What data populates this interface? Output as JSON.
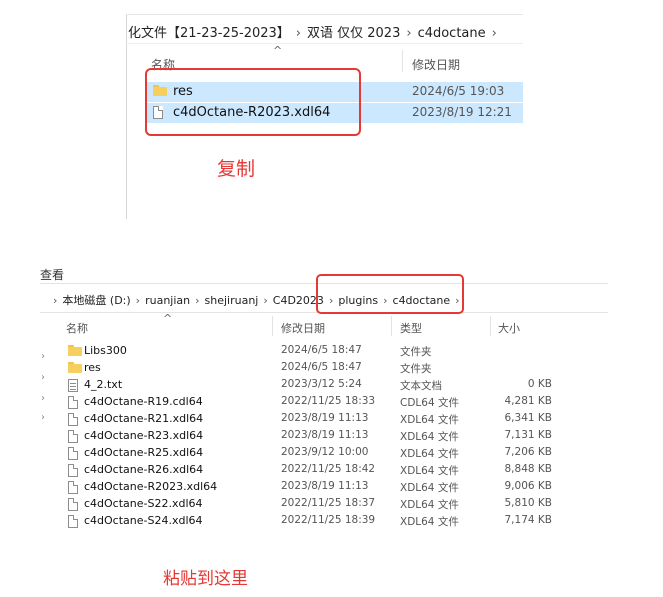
{
  "top_window": {
    "breadcrumb": [
      "化文件【21-23-25-2023】",
      "双语 仅仅 2023",
      "c4doctane"
    ],
    "sort_arrow": "^",
    "columns": {
      "name": "名称",
      "modified": "修改日期"
    },
    "rows": [
      {
        "icon": "folder-icon",
        "name": "res",
        "date": "2024/6/5 19:03"
      },
      {
        "icon": "file-icon",
        "name": "c4dOctane-R2023.xdl64",
        "date": "2023/8/19 12:21"
      }
    ],
    "caption": "复制",
    "highlight_color": "#cce8ff",
    "annotation_color": "#e53935"
  },
  "bottom_window": {
    "title_fragment": "查看",
    "breadcrumb": [
      "本地磁盘 (D:)",
      "ruanjian",
      "shejiruanj",
      "C4D2023",
      "plugins",
      "c4doctane"
    ],
    "sort_arrow": "^",
    "columns": {
      "name": "名称",
      "modified": "修改日期",
      "type": "类型",
      "size": "大小"
    },
    "rows": [
      {
        "icon": "folder-icon",
        "name": "Libs300",
        "date": "2024/6/5 18:47",
        "type": "文件夹",
        "size": ""
      },
      {
        "icon": "folder-icon",
        "name": "res",
        "date": "2024/6/5 18:47",
        "type": "文件夹",
        "size": ""
      },
      {
        "icon": "text-file-icon",
        "name": "4_2.txt",
        "date": "2023/3/12 5:24",
        "type": "文本文档",
        "size": "0 KB"
      },
      {
        "icon": "file-icon",
        "name": "c4dOctane-R19.cdl64",
        "date": "2022/11/25 18:33",
        "type": "CDL64 文件",
        "size": "4,281 KB"
      },
      {
        "icon": "file-icon",
        "name": "c4dOctane-R21.xdl64",
        "date": "2023/8/19 11:13",
        "type": "XDL64 文件",
        "size": "6,341 KB"
      },
      {
        "icon": "file-icon",
        "name": "c4dOctane-R23.xdl64",
        "date": "2023/8/19 11:13",
        "type": "XDL64 文件",
        "size": "7,131 KB"
      },
      {
        "icon": "file-icon",
        "name": "c4dOctane-R25.xdl64",
        "date": "2023/9/12 10:00",
        "type": "XDL64 文件",
        "size": "7,206 KB"
      },
      {
        "icon": "file-icon",
        "name": "c4dOctane-R26.xdl64",
        "date": "2022/11/25 18:42",
        "type": "XDL64 文件",
        "size": "8,848 KB"
      },
      {
        "icon": "file-icon",
        "name": "c4dOctane-R2023.xdl64",
        "date": "2023/8/19 11:13",
        "type": "XDL64 文件",
        "size": "9,006 KB"
      },
      {
        "icon": "file-icon",
        "name": "c4dOctane-S22.xdl64",
        "date": "2022/11/25 18:37",
        "type": "XDL64 文件",
        "size": "5,810 KB"
      },
      {
        "icon": "file-icon",
        "name": "c4dOctane-S24.xdl64",
        "date": "2022/11/25 18:39",
        "type": "XDL64 文件",
        "size": "7,174 KB"
      }
    ],
    "caption": "粘贴到这里"
  }
}
